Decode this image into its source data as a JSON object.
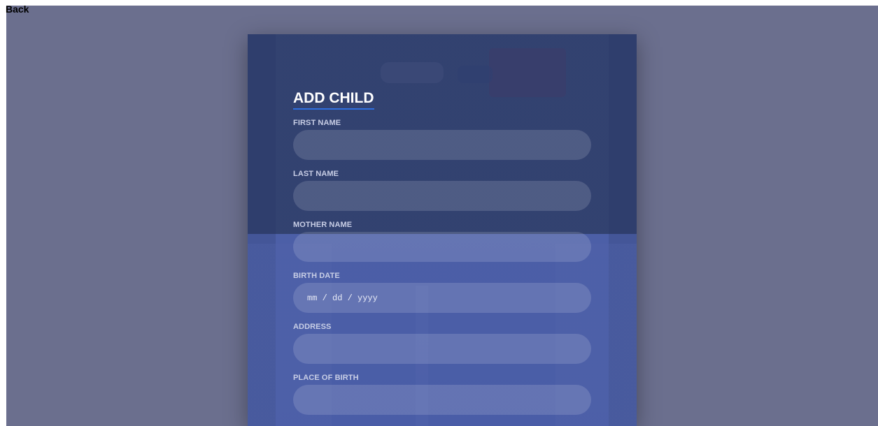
{
  "back_link": "Back",
  "form": {
    "title": "ADD CHILD",
    "fields": [
      {
        "label": "FIRST NAME",
        "value": ""
      },
      {
        "label": "LAST NAME",
        "value": ""
      },
      {
        "label": "MOTHER NAME",
        "value": ""
      },
      {
        "label": "BIRTH DATE",
        "placeholder": "mm / dd / yyyy"
      },
      {
        "label": "ADDRESS",
        "value": ""
      },
      {
        "label": "PLACE OF BIRTH",
        "value": ""
      }
    ]
  },
  "colors": {
    "page_background": "#6b6f8e",
    "title_underline": "#2f6fe0",
    "label_text": "#c9cfe6"
  }
}
